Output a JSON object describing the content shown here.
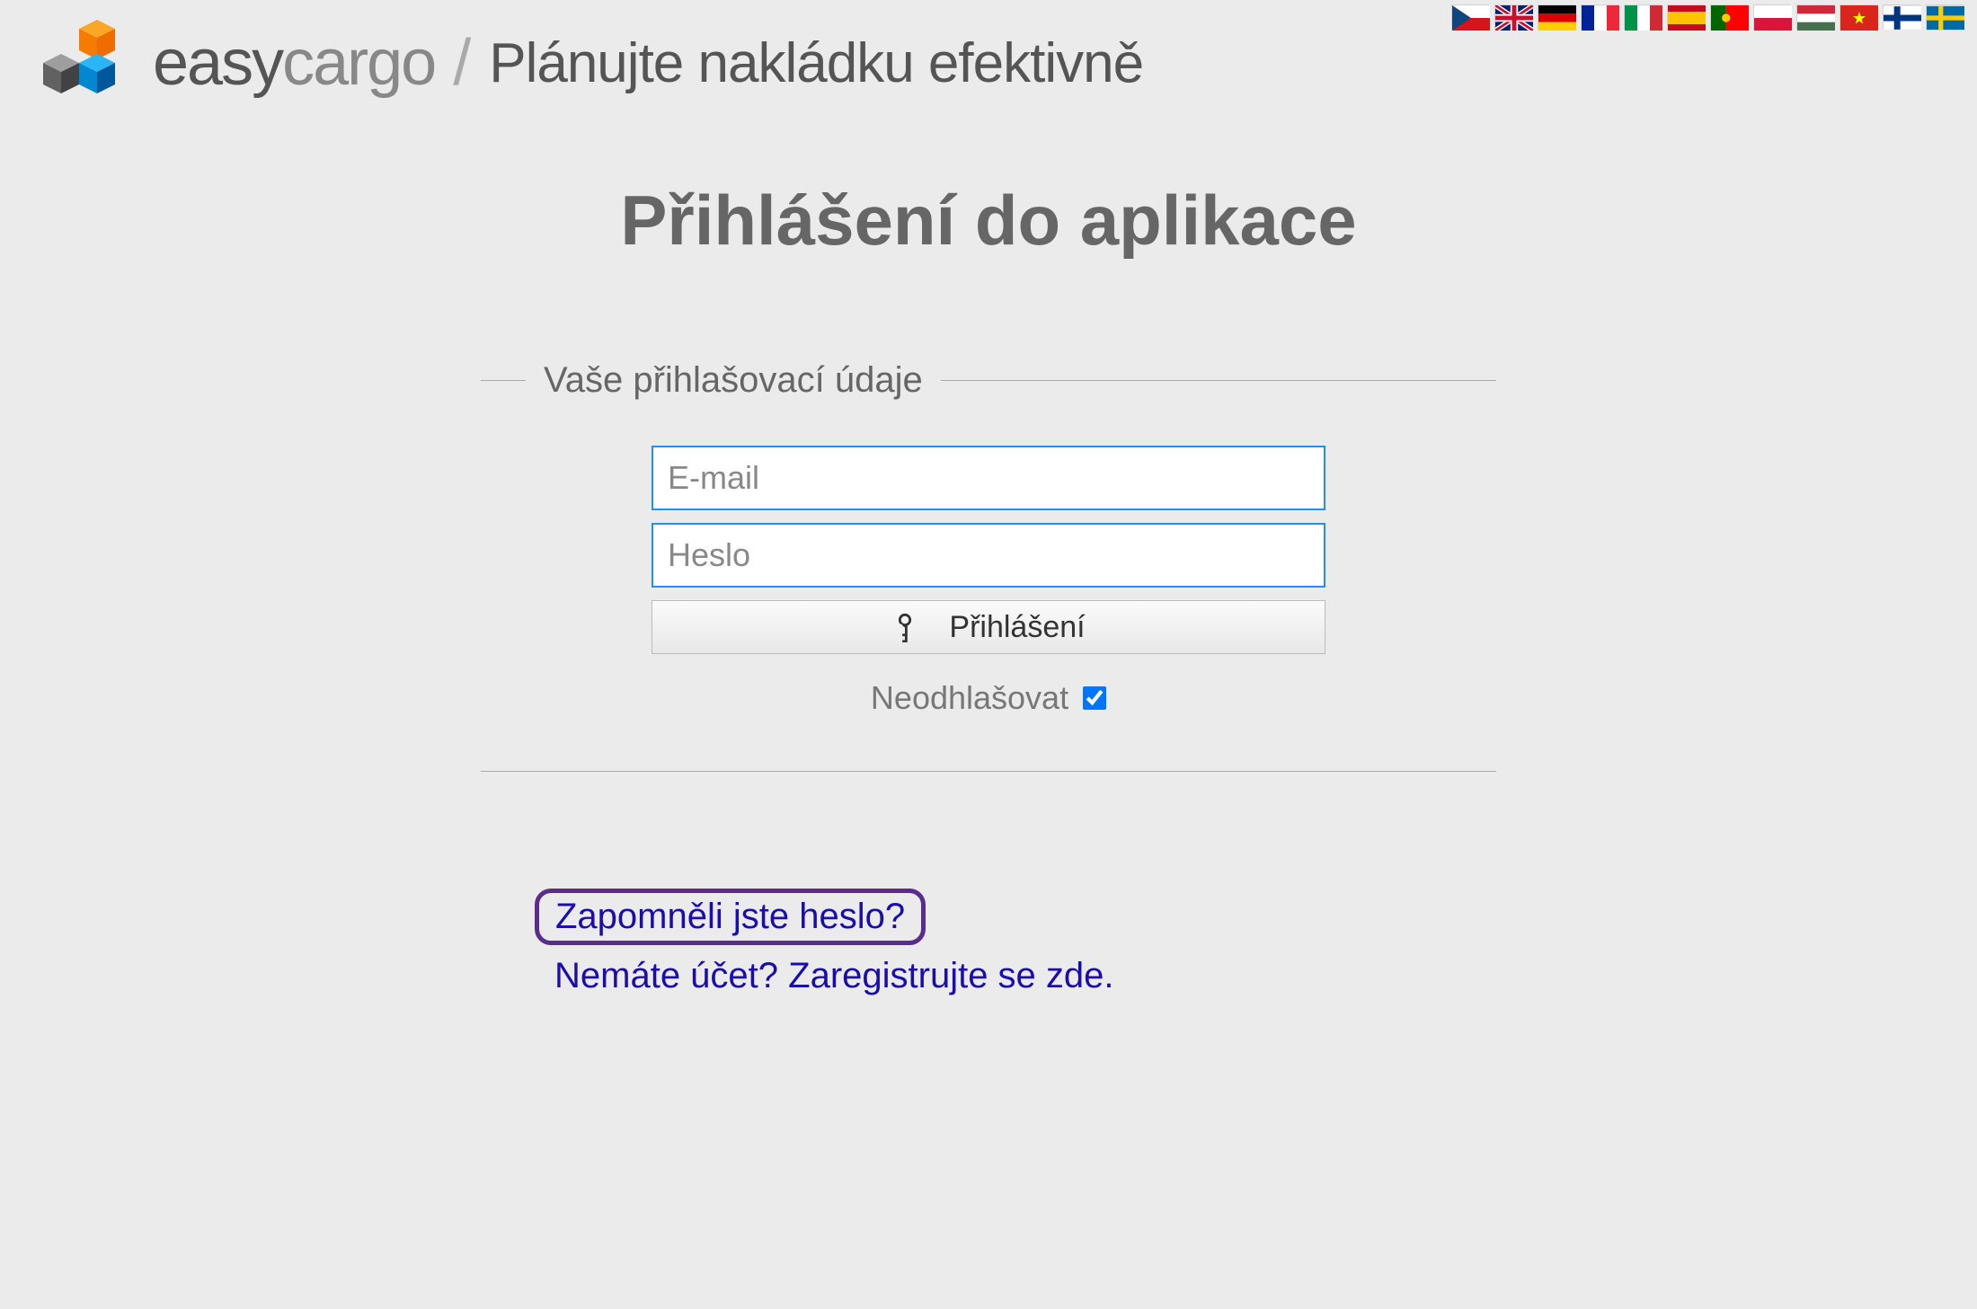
{
  "header": {
    "brand_easy": "easy",
    "brand_cargo": "cargo",
    "separator": "/",
    "tagline": "Plánujte nakládku efektivně"
  },
  "flags": [
    {
      "name": "cz",
      "title": "Čeština"
    },
    {
      "name": "gb",
      "title": "English"
    },
    {
      "name": "de",
      "title": "Deutsch"
    },
    {
      "name": "fr",
      "title": "Français"
    },
    {
      "name": "it",
      "title": "Italiano"
    },
    {
      "name": "es",
      "title": "Español"
    },
    {
      "name": "pt",
      "title": "Português"
    },
    {
      "name": "pl",
      "title": "Polski"
    },
    {
      "name": "hu",
      "title": "Magyar"
    },
    {
      "name": "vn",
      "title": "Tiếng Việt"
    },
    {
      "name": "fi",
      "title": "Suomi"
    },
    {
      "name": "se",
      "title": "Svenska"
    }
  ],
  "login": {
    "page_title": "Přihlášení do aplikace",
    "fieldset_label": "Vaše přihlašovací údaje",
    "email_placeholder": "E-mail",
    "password_placeholder": "Heslo",
    "submit_label": "Přihlášení",
    "remember_label": "Neodhlašovat",
    "remember_checked": true
  },
  "links": {
    "forgot_password": "Zapomněli jste heslo?",
    "register": "Nemáte účet? Zaregistrujte se zde."
  }
}
